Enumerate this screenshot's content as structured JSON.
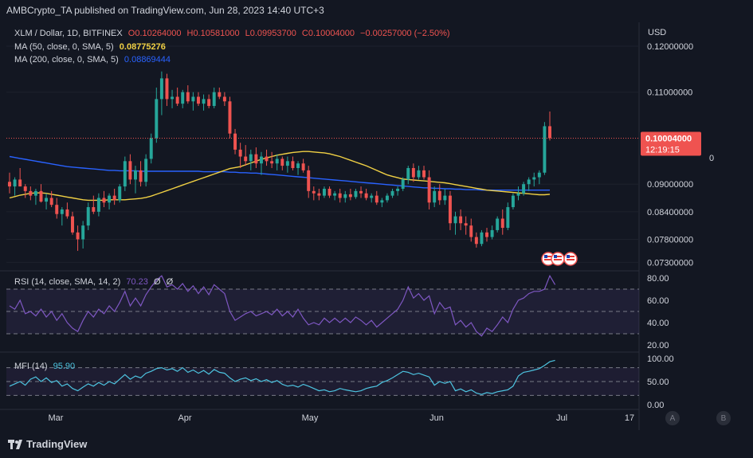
{
  "header": {
    "publisher": "AMBCrypto_TA published on TradingView.com, Jun 28, 2023 14:40 UTC+3"
  },
  "legend": {
    "symbol": "XLM / Dollar, 1D, BITFINEX",
    "ohlc": {
      "open": "O0.10264000",
      "high": "H0.10581000",
      "low": "L0.09953700",
      "close": "C0.10004000",
      "change": "−0.00257000 (−2.50%)"
    },
    "ma50_label": "MA (50, close, 0, SMA, 5)",
    "ma50_value": "0.08775276",
    "ma200_label": "MA (200, close, 0, SMA, 5)",
    "ma200_value": "0.08869444"
  },
  "rsi_legend": {
    "label": "RSI (14, close, SMA, 14, 2)",
    "value": "70.23",
    "extra1": "Ø",
    "extra2": "Ø"
  },
  "mfi_legend": {
    "label": "MFI (14)",
    "value": "95.90"
  },
  "price_axis": {
    "currency": "USD",
    "ticks": [
      "0.12000000",
      "0.11000000",
      "0.09000000",
      "0.08400000",
      "0.07800000",
      "0.07300000"
    ],
    "tick_values": [
      0.12,
      0.11,
      0.09,
      0.084,
      0.078,
      0.073
    ],
    "current_price": "0.10004000",
    "countdown": "12:19:15",
    "right_label": "0"
  },
  "rsi_axis": {
    "ticks": [
      "80.00",
      "60.00",
      "40.00",
      "20.00"
    ],
    "tick_values": [
      80,
      60,
      40,
      20
    ]
  },
  "mfi_axis": {
    "ticks": [
      "100.00",
      "50.00",
      "0.00"
    ],
    "tick_values": [
      100,
      50,
      0
    ]
  },
  "time_axis": {
    "labels": [
      "Mar",
      "Apr",
      "May",
      "Jun",
      "Jul",
      "17"
    ]
  },
  "buttons": {
    "a": "A",
    "b": "B"
  },
  "footer": {
    "brand": "TradingView"
  },
  "colors": {
    "up": "#26a69a",
    "down": "#ef5350",
    "ma50": "#f0d044",
    "ma200": "#2962ff",
    "rsi": "#7e57c2",
    "mfi": "#4dc4e0",
    "bg": "#131722"
  },
  "chart_data": {
    "type": "candlestick",
    "title": "XLM / Dollar, 1D, BITFINEX",
    "y_range": [
      0.0715,
      0.1245
    ],
    "candles": [
      {
        "o": 0.0905,
        "h": 0.0925,
        "l": 0.088,
        "c": 0.0895
      },
      {
        "o": 0.0895,
        "h": 0.0915,
        "l": 0.0875,
        "c": 0.091
      },
      {
        "o": 0.091,
        "h": 0.0935,
        "l": 0.0895,
        "c": 0.0895
      },
      {
        "o": 0.0895,
        "h": 0.09,
        "l": 0.087,
        "c": 0.0885
      },
      {
        "o": 0.0885,
        "h": 0.0895,
        "l": 0.0865,
        "c": 0.0875
      },
      {
        "o": 0.0875,
        "h": 0.089,
        "l": 0.0855,
        "c": 0.0885
      },
      {
        "o": 0.0885,
        "h": 0.09,
        "l": 0.086,
        "c": 0.0862
      },
      {
        "o": 0.0862,
        "h": 0.088,
        "l": 0.0845,
        "c": 0.087
      },
      {
        "o": 0.087,
        "h": 0.0885,
        "l": 0.085,
        "c": 0.0855
      },
      {
        "o": 0.0855,
        "h": 0.087,
        "l": 0.0825,
        "c": 0.0835
      },
      {
        "o": 0.0835,
        "h": 0.085,
        "l": 0.081,
        "c": 0.0845
      },
      {
        "o": 0.0845,
        "h": 0.086,
        "l": 0.0825,
        "c": 0.083
      },
      {
        "o": 0.083,
        "h": 0.084,
        "l": 0.079,
        "c": 0.0795
      },
      {
        "o": 0.0795,
        "h": 0.081,
        "l": 0.0755,
        "c": 0.078
      },
      {
        "o": 0.078,
        "h": 0.082,
        "l": 0.076,
        "c": 0.081
      },
      {
        "o": 0.081,
        "h": 0.086,
        "l": 0.08,
        "c": 0.085
      },
      {
        "o": 0.085,
        "h": 0.0875,
        "l": 0.0835,
        "c": 0.084
      },
      {
        "o": 0.084,
        "h": 0.088,
        "l": 0.083,
        "c": 0.087
      },
      {
        "o": 0.087,
        "h": 0.0885,
        "l": 0.085,
        "c": 0.086
      },
      {
        "o": 0.086,
        "h": 0.088,
        "l": 0.0845,
        "c": 0.0875
      },
      {
        "o": 0.0875,
        "h": 0.089,
        "l": 0.0855,
        "c": 0.0865
      },
      {
        "o": 0.0865,
        "h": 0.09,
        "l": 0.086,
        "c": 0.0895
      },
      {
        "o": 0.0895,
        "h": 0.096,
        "l": 0.0885,
        "c": 0.095
      },
      {
        "o": 0.095,
        "h": 0.0965,
        "l": 0.09,
        "c": 0.091
      },
      {
        "o": 0.091,
        "h": 0.094,
        "l": 0.088,
        "c": 0.093
      },
      {
        "o": 0.093,
        "h": 0.095,
        "l": 0.0895,
        "c": 0.0905
      },
      {
        "o": 0.0905,
        "h": 0.0965,
        "l": 0.0895,
        "c": 0.0955
      },
      {
        "o": 0.0955,
        "h": 0.101,
        "l": 0.0945,
        "c": 0.1
      },
      {
        "o": 0.1,
        "h": 0.111,
        "l": 0.099,
        "c": 0.1085
      },
      {
        "o": 0.1085,
        "h": 0.1145,
        "l": 0.105,
        "c": 0.113
      },
      {
        "o": 0.113,
        "h": 0.114,
        "l": 0.107,
        "c": 0.1085
      },
      {
        "o": 0.1085,
        "h": 0.1105,
        "l": 0.1065,
        "c": 0.109
      },
      {
        "o": 0.109,
        "h": 0.111,
        "l": 0.107,
        "c": 0.1075
      },
      {
        "o": 0.1075,
        "h": 0.1105,
        "l": 0.1065,
        "c": 0.11
      },
      {
        "o": 0.11,
        "h": 0.1115,
        "l": 0.1075,
        "c": 0.108
      },
      {
        "o": 0.108,
        "h": 0.11,
        "l": 0.106,
        "c": 0.109
      },
      {
        "o": 0.109,
        "h": 0.11,
        "l": 0.107,
        "c": 0.1075
      },
      {
        "o": 0.1075,
        "h": 0.1095,
        "l": 0.106,
        "c": 0.1085
      },
      {
        "o": 0.1085,
        "h": 0.1095,
        "l": 0.1065,
        "c": 0.107
      },
      {
        "o": 0.107,
        "h": 0.111,
        "l": 0.1065,
        "c": 0.11
      },
      {
        "o": 0.11,
        "h": 0.111,
        "l": 0.1085,
        "c": 0.109
      },
      {
        "o": 0.109,
        "h": 0.11,
        "l": 0.107,
        "c": 0.108
      },
      {
        "o": 0.108,
        "h": 0.109,
        "l": 0.1,
        "c": 0.101
      },
      {
        "o": 0.101,
        "h": 0.102,
        "l": 0.0965,
        "c": 0.0975
      },
      {
        "o": 0.0975,
        "h": 0.099,
        "l": 0.0935,
        "c": 0.096
      },
      {
        "o": 0.096,
        "h": 0.0985,
        "l": 0.094,
        "c": 0.095
      },
      {
        "o": 0.095,
        "h": 0.0975,
        "l": 0.093,
        "c": 0.0965
      },
      {
        "o": 0.0965,
        "h": 0.098,
        "l": 0.0935,
        "c": 0.0945
      },
      {
        "o": 0.0945,
        "h": 0.097,
        "l": 0.092,
        "c": 0.096
      },
      {
        "o": 0.096,
        "h": 0.0975,
        "l": 0.094,
        "c": 0.095
      },
      {
        "o": 0.095,
        "h": 0.097,
        "l": 0.0935,
        "c": 0.0945
      },
      {
        "o": 0.0945,
        "h": 0.0965,
        "l": 0.093,
        "c": 0.0955
      },
      {
        "o": 0.0955,
        "h": 0.096,
        "l": 0.093,
        "c": 0.094
      },
      {
        "o": 0.094,
        "h": 0.096,
        "l": 0.0925,
        "c": 0.095
      },
      {
        "o": 0.095,
        "h": 0.096,
        "l": 0.093,
        "c": 0.0935
      },
      {
        "o": 0.0935,
        "h": 0.095,
        "l": 0.092,
        "c": 0.0945
      },
      {
        "o": 0.0945,
        "h": 0.0955,
        "l": 0.0925,
        "c": 0.093
      },
      {
        "o": 0.093,
        "h": 0.094,
        "l": 0.087,
        "c": 0.0885
      },
      {
        "o": 0.0885,
        "h": 0.0895,
        "l": 0.0865,
        "c": 0.088
      },
      {
        "o": 0.088,
        "h": 0.089,
        "l": 0.0865,
        "c": 0.0875
      },
      {
        "o": 0.0875,
        "h": 0.0895,
        "l": 0.087,
        "c": 0.089
      },
      {
        "o": 0.089,
        "h": 0.0895,
        "l": 0.087,
        "c": 0.0875
      },
      {
        "o": 0.0875,
        "h": 0.0885,
        "l": 0.0865,
        "c": 0.088
      },
      {
        "o": 0.088,
        "h": 0.089,
        "l": 0.086,
        "c": 0.087
      },
      {
        "o": 0.087,
        "h": 0.0885,
        "l": 0.086,
        "c": 0.0878
      },
      {
        "o": 0.0878,
        "h": 0.089,
        "l": 0.0865,
        "c": 0.0872
      },
      {
        "o": 0.0872,
        "h": 0.089,
        "l": 0.0868,
        "c": 0.0885
      },
      {
        "o": 0.0885,
        "h": 0.0895,
        "l": 0.087,
        "c": 0.088
      },
      {
        "o": 0.088,
        "h": 0.089,
        "l": 0.0865,
        "c": 0.087
      },
      {
        "o": 0.087,
        "h": 0.088,
        "l": 0.086,
        "c": 0.0875
      },
      {
        "o": 0.0875,
        "h": 0.0885,
        "l": 0.0855,
        "c": 0.086
      },
      {
        "o": 0.086,
        "h": 0.087,
        "l": 0.085,
        "c": 0.0865
      },
      {
        "o": 0.0865,
        "h": 0.088,
        "l": 0.086,
        "c": 0.0875
      },
      {
        "o": 0.0875,
        "h": 0.089,
        "l": 0.087,
        "c": 0.0885
      },
      {
        "o": 0.0885,
        "h": 0.0895,
        "l": 0.0875,
        "c": 0.089
      },
      {
        "o": 0.089,
        "h": 0.0915,
        "l": 0.0885,
        "c": 0.091
      },
      {
        "o": 0.091,
        "h": 0.094,
        "l": 0.09,
        "c": 0.0935
      },
      {
        "o": 0.0935,
        "h": 0.0945,
        "l": 0.0905,
        "c": 0.0915
      },
      {
        "o": 0.0915,
        "h": 0.094,
        "l": 0.091,
        "c": 0.093
      },
      {
        "o": 0.093,
        "h": 0.094,
        "l": 0.091,
        "c": 0.0915
      },
      {
        "o": 0.0915,
        "h": 0.093,
        "l": 0.0845,
        "c": 0.086
      },
      {
        "o": 0.086,
        "h": 0.0895,
        "l": 0.085,
        "c": 0.0885
      },
      {
        "o": 0.0885,
        "h": 0.09,
        "l": 0.0855,
        "c": 0.0865
      },
      {
        "o": 0.0865,
        "h": 0.089,
        "l": 0.0855,
        "c": 0.0875
      },
      {
        "o": 0.0875,
        "h": 0.0885,
        "l": 0.08,
        "c": 0.0815
      },
      {
        "o": 0.0815,
        "h": 0.084,
        "l": 0.079,
        "c": 0.083
      },
      {
        "o": 0.083,
        "h": 0.0845,
        "l": 0.08,
        "c": 0.0815
      },
      {
        "o": 0.0815,
        "h": 0.083,
        "l": 0.079,
        "c": 0.081
      },
      {
        "o": 0.081,
        "h": 0.0825,
        "l": 0.0775,
        "c": 0.0785
      },
      {
        "o": 0.0785,
        "h": 0.0795,
        "l": 0.0762,
        "c": 0.077
      },
      {
        "o": 0.077,
        "h": 0.08,
        "l": 0.0765,
        "c": 0.0795
      },
      {
        "o": 0.0795,
        "h": 0.0805,
        "l": 0.0775,
        "c": 0.0785
      },
      {
        "o": 0.0785,
        "h": 0.081,
        "l": 0.078,
        "c": 0.08
      },
      {
        "o": 0.08,
        "h": 0.083,
        "l": 0.0795,
        "c": 0.0825
      },
      {
        "o": 0.0825,
        "h": 0.0845,
        "l": 0.079,
        "c": 0.0805
      },
      {
        "o": 0.0805,
        "h": 0.086,
        "l": 0.08,
        "c": 0.085
      },
      {
        "o": 0.085,
        "h": 0.088,
        "l": 0.0845,
        "c": 0.0875
      },
      {
        "o": 0.0875,
        "h": 0.0895,
        "l": 0.0865,
        "c": 0.088
      },
      {
        "o": 0.088,
        "h": 0.0905,
        "l": 0.0875,
        "c": 0.09
      },
      {
        "o": 0.09,
        "h": 0.0915,
        "l": 0.0885,
        "c": 0.091
      },
      {
        "o": 0.091,
        "h": 0.0925,
        "l": 0.0895,
        "c": 0.0915
      },
      {
        "o": 0.0915,
        "h": 0.093,
        "l": 0.09,
        "c": 0.0925
      },
      {
        "o": 0.0925,
        "h": 0.1035,
        "l": 0.092,
        "c": 0.1026
      },
      {
        "o": 0.1026,
        "h": 0.1058,
        "l": 0.0995,
        "c": 0.1
      }
    ],
    "ma50": [
      0.087,
      0.0873,
      0.0876,
      0.0878,
      0.088,
      0.0881,
      0.0881,
      0.088,
      0.0878,
      0.0876,
      0.0874,
      0.0872,
      0.087,
      0.0868,
      0.0866,
      0.0865,
      0.0865,
      0.0865,
      0.0865,
      0.0866,
      0.0866,
      0.0866,
      0.0866,
      0.0867,
      0.0868,
      0.0869,
      0.0871,
      0.0874,
      0.0878,
      0.0882,
      0.0886,
      0.089,
      0.0894,
      0.0898,
      0.0902,
      0.0906,
      0.091,
      0.0914,
      0.0918,
      0.0922,
      0.0926,
      0.093,
      0.0934,
      0.0936,
      0.0938,
      0.0942,
      0.0946,
      0.095,
      0.0954,
      0.0957,
      0.096,
      0.0963,
      0.0965,
      0.0967,
      0.0969,
      0.097,
      0.0971,
      0.0971,
      0.097,
      0.0969,
      0.0968,
      0.0966,
      0.0963,
      0.096,
      0.0956,
      0.0952,
      0.0948,
      0.0944,
      0.094,
      0.0935,
      0.093,
      0.0925,
      0.092,
      0.0917,
      0.0914,
      0.0911,
      0.091,
      0.0909,
      0.0908,
      0.0907,
      0.0906,
      0.0905,
      0.0904,
      0.0903,
      0.0901,
      0.0899,
      0.0897,
      0.0895,
      0.0893,
      0.0891,
      0.0889,
      0.0887,
      0.0886,
      0.0885,
      0.0884,
      0.0883,
      0.0882,
      0.0881,
      0.088,
      0.0879,
      0.0878,
      0.0877,
      0.0877,
      0.0878
    ],
    "ma200": [
      0.096,
      0.0958,
      0.0956,
      0.0954,
      0.0952,
      0.095,
      0.0948,
      0.0946,
      0.0944,
      0.0942,
      0.094,
      0.0938,
      0.0937,
      0.0936,
      0.0935,
      0.0934,
      0.0933,
      0.0932,
      0.0931,
      0.093,
      0.093,
      0.0929,
      0.0929,
      0.0929,
      0.0929,
      0.0928,
      0.0928,
      0.0928,
      0.0928,
      0.0928,
      0.0928,
      0.0928,
      0.0928,
      0.0928,
      0.0928,
      0.0928,
      0.0928,
      0.0927,
      0.0927,
      0.0927,
      0.0927,
      0.0927,
      0.0926,
      0.0926,
      0.0925,
      0.0925,
      0.0924,
      0.0924,
      0.0923,
      0.0922,
      0.0921,
      0.092,
      0.0919,
      0.0918,
      0.0917,
      0.0916,
      0.0915,
      0.0914,
      0.0913,
      0.0912,
      0.0911,
      0.091,
      0.0909,
      0.0908,
      0.0907,
      0.0906,
      0.0905,
      0.0904,
      0.0903,
      0.0902,
      0.0901,
      0.09,
      0.0899,
      0.0898,
      0.0897,
      0.0896,
      0.0895,
      0.0894,
      0.0893,
      0.0892,
      0.0892,
      0.0891,
      0.0891,
      0.089,
      0.089,
      0.0889,
      0.0889,
      0.0888,
      0.0888,
      0.0888,
      0.0887,
      0.0887,
      0.0887,
      0.0887,
      0.0887,
      0.0887,
      0.0887,
      0.0887,
      0.0887,
      0.0887,
      0.0887,
      0.0887,
      0.0887,
      0.0887
    ],
    "rsi_range": [
      15,
      85
    ],
    "rsi": [
      55,
      52,
      60,
      48,
      50,
      46,
      52,
      45,
      50,
      42,
      48,
      40,
      35,
      32,
      42,
      50,
      45,
      52,
      48,
      55,
      50,
      58,
      68,
      55,
      62,
      55,
      65,
      72,
      78,
      82,
      72,
      74,
      70,
      75,
      68,
      73,
      66,
      72,
      65,
      74,
      70,
      66,
      50,
      42,
      45,
      48,
      50,
      46,
      48,
      50,
      47,
      52,
      46,
      50,
      45,
      52,
      44,
      38,
      40,
      38,
      44,
      40,
      44,
      40,
      44,
      40,
      45,
      42,
      38,
      42,
      36,
      40,
      44,
      48,
      52,
      60,
      72,
      62,
      66,
      60,
      64,
      48,
      58,
      52,
      54,
      38,
      42,
      36,
      40,
      32,
      28,
      35,
      32,
      38,
      45,
      40,
      52,
      60,
      62,
      66,
      68,
      68,
      70,
      82,
      74
    ],
    "mfi_range": [
      0,
      100
    ],
    "mfi": [
      40,
      45,
      50,
      42,
      55,
      60,
      50,
      58,
      48,
      52,
      40,
      45,
      35,
      30,
      38,
      45,
      40,
      48,
      42,
      50,
      45,
      55,
      65,
      55,
      62,
      58,
      68,
      72,
      78,
      80,
      75,
      78,
      72,
      80,
      70,
      75,
      68,
      74,
      66,
      76,
      70,
      68,
      58,
      50,
      55,
      58,
      52,
      56,
      50,
      54,
      48,
      52,
      44,
      40,
      42,
      38,
      44,
      40,
      35,
      30,
      32,
      28,
      30,
      35,
      32,
      30,
      28,
      30,
      35,
      38,
      40,
      48,
      52,
      58,
      65,
      72,
      70,
      65,
      68,
      64,
      60,
      42,
      50,
      46,
      50,
      30,
      34,
      28,
      32,
      25,
      22,
      26,
      24,
      28,
      30,
      32,
      40,
      62,
      70,
      72,
      75,
      78,
      85,
      93,
      95.9
    ]
  }
}
